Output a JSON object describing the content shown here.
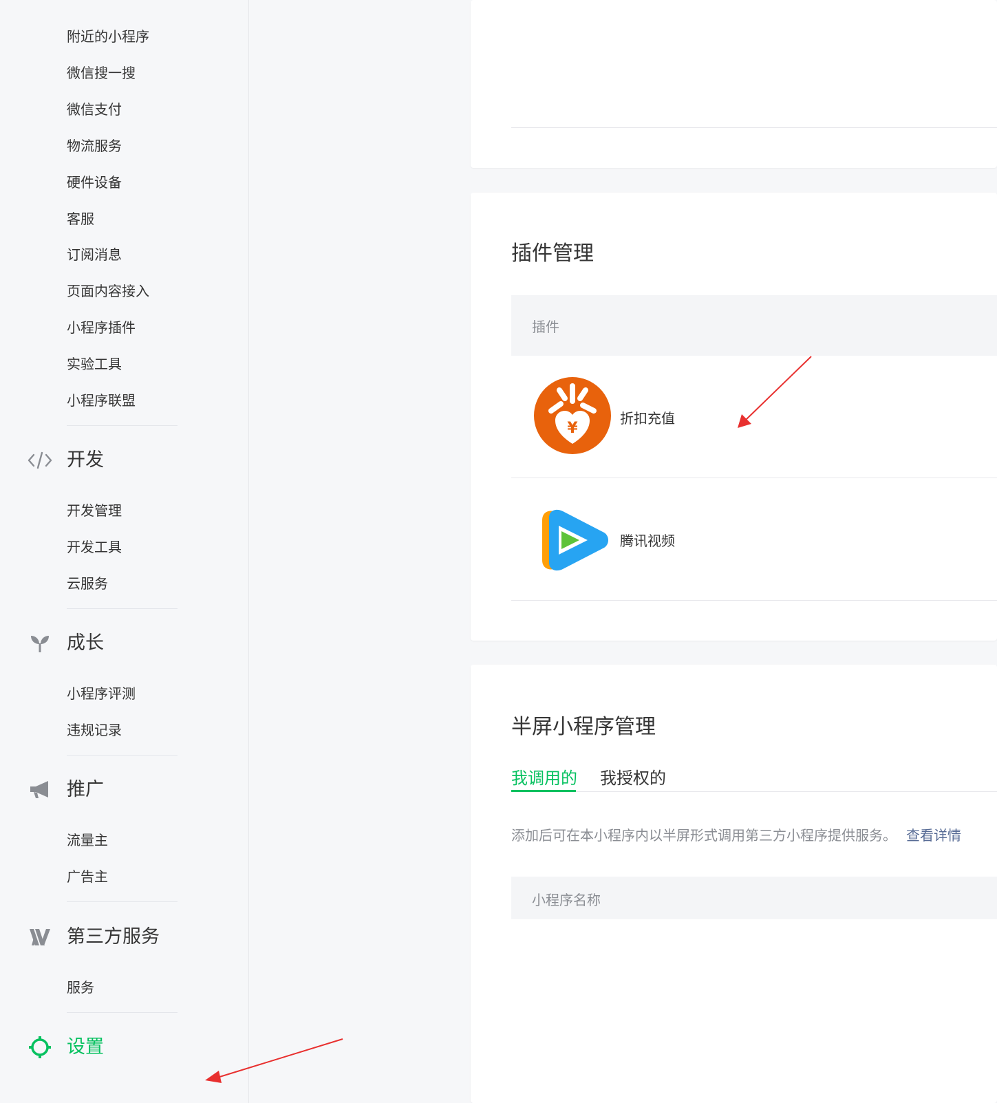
{
  "sidebar": {
    "top_items": [
      "附近的小程序",
      "微信搜一搜",
      "微信支付",
      "物流服务",
      "硬件设备",
      "客服",
      "订阅消息",
      "页面内容接入",
      "小程序插件",
      "实验工具",
      "小程序联盟"
    ],
    "dev": {
      "title": "开发",
      "items": [
        "开发管理",
        "开发工具",
        "云服务"
      ]
    },
    "growth": {
      "title": "成长",
      "items": [
        "小程序评测",
        "违规记录"
      ]
    },
    "promo": {
      "title": "推广",
      "items": [
        "流量主",
        "广告主"
      ]
    },
    "third": {
      "title": "第三方服务",
      "items": [
        "服务"
      ]
    },
    "settings": {
      "title": "设置"
    }
  },
  "plugin_card": {
    "title": "插件管理",
    "header_col": "插件",
    "plugins": [
      {
        "name": "折扣充值",
        "icon": "sheng-discount-icon"
      },
      {
        "name": "腾讯视频",
        "icon": "tencent-video-icon"
      }
    ]
  },
  "halfscreen_card": {
    "title": "半屏小程序管理",
    "tabs": [
      "我调用的",
      "我授权的"
    ],
    "active_tab": 0,
    "desc": "添加后可在本小程序内以半屏形式调用第三方小程序提供服务。",
    "desc_link": "查看详情",
    "header_col": "小程序名称"
  },
  "colors": {
    "accent": "#07c160",
    "link": "#576b95",
    "annotation_arrow": "#e8302f"
  }
}
